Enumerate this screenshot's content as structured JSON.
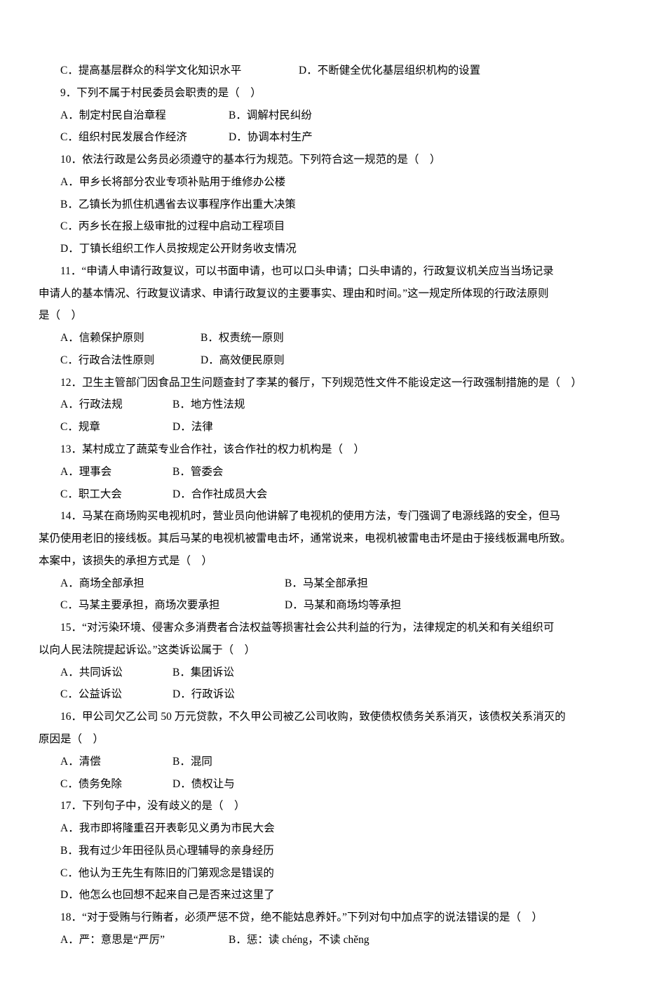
{
  "q8opts_cd": {
    "c": "C．提高基层群众的科学文化知识水平",
    "d": "D．不断健全优化基层组织机构的设置"
  },
  "q9": {
    "stem": "9．下列不属于村民委员会职责的是（　）",
    "a": "A．制定村民自治章程",
    "b": "B．调解村民纠纷",
    "c": "C．组织村民发展合作经济",
    "d": "D．协调本村生产"
  },
  "q10": {
    "stem": "10．依法行政是公务员必须遵守的基本行为规范。下列符合这一规范的是（　）",
    "a": "A．甲乡长将部分农业专项补贴用于维修办公楼",
    "b": "B．乙镇长为抓住机遇省去议事程序作出重大决策",
    "c": "C．丙乡长在报上级审批的过程中启动工程项目",
    "d": "D．丁镇长组织工作人员按规定公开财务收支情况"
  },
  "q11": {
    "stem_l1": "11．“申请人申请行政复议，可以书面申请，也可以口头申请；口头申请的，行政复议机关应当当场记录",
    "stem_l2": "申请人的基本情况、行政复议请求、申请行政复议的主要事实、理由和时间。”这一规定所体现的行政法原则",
    "stem_l3": "是（　）",
    "a": "A．信赖保护原则",
    "b": "B．权责统一原则",
    "c": "C．行政合法性原则",
    "d": "D．高效便民原则"
  },
  "q12": {
    "stem": "12．卫生主管部门因食品卫生问题查封了李某的餐厅，下列规范性文件不能设定这一行政强制措施的是（　）",
    "a": "A．行政法规",
    "b": "B．地方性法规",
    "c": "C．规章",
    "d": "D．法律"
  },
  "q13": {
    "stem": "13．某村成立了蔬菜专业合作社，该合作社的权力机构是（　）",
    "a": "A．理事会",
    "b": "B．管委会",
    "c": "C．职工大会",
    "d": "D．合作社成员大会"
  },
  "q14": {
    "stem_l1": "14．马某在商场购买电视机时，营业员向他讲解了电视机的使用方法，专门强调了电源线路的安全，但马",
    "stem_l2": "某仍使用老旧的接线板。其后马某的电视机被雷电击坏，通常说来，电视机被雷电击坏是由于接线板漏电所致。",
    "stem_l3": "本案中，该损失的承担方式是（　）",
    "a": "A．商场全部承担",
    "b": "B．马某全部承担",
    "c": "C．马某主要承担，商场次要承担",
    "d": "D．马某和商场均等承担"
  },
  "q15": {
    "stem_l1": "15．“对污染环境、侵害众多消费者合法权益等损害社会公共利益的行为，法律规定的机关和有关组织可",
    "stem_l2": "以向人民法院提起诉讼。”这类诉讼属于（　）",
    "a": "A．共同诉讼",
    "b": "B．集团诉讼",
    "c": "C．公益诉讼",
    "d": "D．行政诉讼"
  },
  "q16": {
    "stem_l1": "16．甲公司欠乙公司 50 万元贷款，不久甲公司被乙公司收购，致使债权债务关系消灭，该债权关系消灭的",
    "stem_l2": "原因是（　）",
    "a": "A．清偿",
    "b": "B．混同",
    "c": "C．债务免除",
    "d": "D．债权让与"
  },
  "q17": {
    "stem": "17．下列句子中，没有歧义的是（　）",
    "a": "A．我市即将隆重召开表彰见义勇为市民大会",
    "b": "B．我有过少年田径队员心理辅导的亲身经历",
    "c": "C．他认为王先生有陈旧的门第观念是错误的",
    "d": "D．他怎么也回想不起来自己是否来过这里了"
  },
  "q18": {
    "stem": "18．“对于受贿与行贿者，必须严惩不贷，绝不能姑息养奸。”下列对句中加点字的说法错误的是（　）",
    "a": "A．严：意思是“严厉”",
    "b": "B．惩：读 chéng，不读 chěng"
  }
}
